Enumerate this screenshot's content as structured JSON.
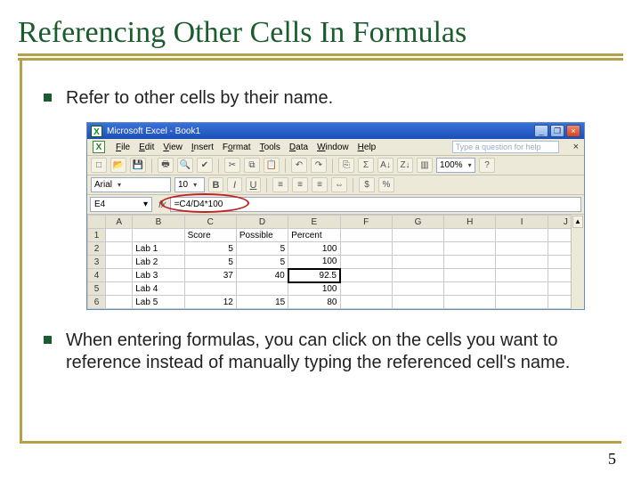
{
  "title": "Referencing Other Cells In Formulas",
  "bullets": {
    "b1": "Refer to other cells by their name.",
    "b2": "When entering formulas, you can click on the cells you want to reference instead of manually typing the referenced cell's name."
  },
  "page_number": "5",
  "excel": {
    "app_title": "Microsoft Excel - Book1",
    "help_placeholder": "Type a question for help",
    "menus": {
      "file": "File",
      "edit": "Edit",
      "view": "View",
      "insert": "Insert",
      "format": "Format",
      "tools": "Tools",
      "data": "Data",
      "window": "Window",
      "help": "Help"
    },
    "font_name": "Arial",
    "font_size": "10",
    "name_box": "E4",
    "formula": "=C4/D4*100",
    "columns": [
      "A",
      "B",
      "C",
      "D",
      "E",
      "F",
      "G",
      "H",
      "I",
      "J"
    ],
    "headers": {
      "B": "",
      "C": "Score",
      "D": "Possible",
      "E": "Percent"
    },
    "rows": [
      {
        "n": "1",
        "B": "",
        "C": "Score",
        "D": "Possible",
        "E": "Percent"
      },
      {
        "n": "2",
        "B": "Lab 1",
        "C": "5",
        "D": "5",
        "E": "100"
      },
      {
        "n": "3",
        "B": "Lab 2",
        "C": "5",
        "D": "5",
        "E": "100"
      },
      {
        "n": "4",
        "B": "Lab 3",
        "C": "37",
        "D": "40",
        "E": "92.5"
      },
      {
        "n": "5",
        "B": "Lab 4",
        "C": "",
        "D": "",
        "E": "100"
      },
      {
        "n": "6",
        "B": "Lab 5",
        "C": "12",
        "D": "15",
        "E": "80"
      }
    ]
  },
  "icons": {
    "min": "_",
    "max": "❐",
    "close": "×",
    "new": "□",
    "open": "📂",
    "save": "💾",
    "print": "🖶",
    "preview": "🔍",
    "spell": "✔",
    "cut": "✂",
    "copy": "⧉",
    "paste": "📋",
    "undo": "↶",
    "redo": "↷",
    "link": "⎘",
    "sum": "Σ",
    "sort_asc": "A↓",
    "sort_desc": "Z↓",
    "chart": "▥",
    "zoom": "100%",
    "help": "?",
    "bold": "B",
    "italic": "I",
    "underline": "U",
    "al": "≡",
    "ac": "≡",
    "ar": "≡",
    "merge": "⇔",
    "currency": "$",
    "percent": "%",
    "dd": "▾",
    "fx": "fx",
    "up": "▲",
    "dn": "▼"
  }
}
